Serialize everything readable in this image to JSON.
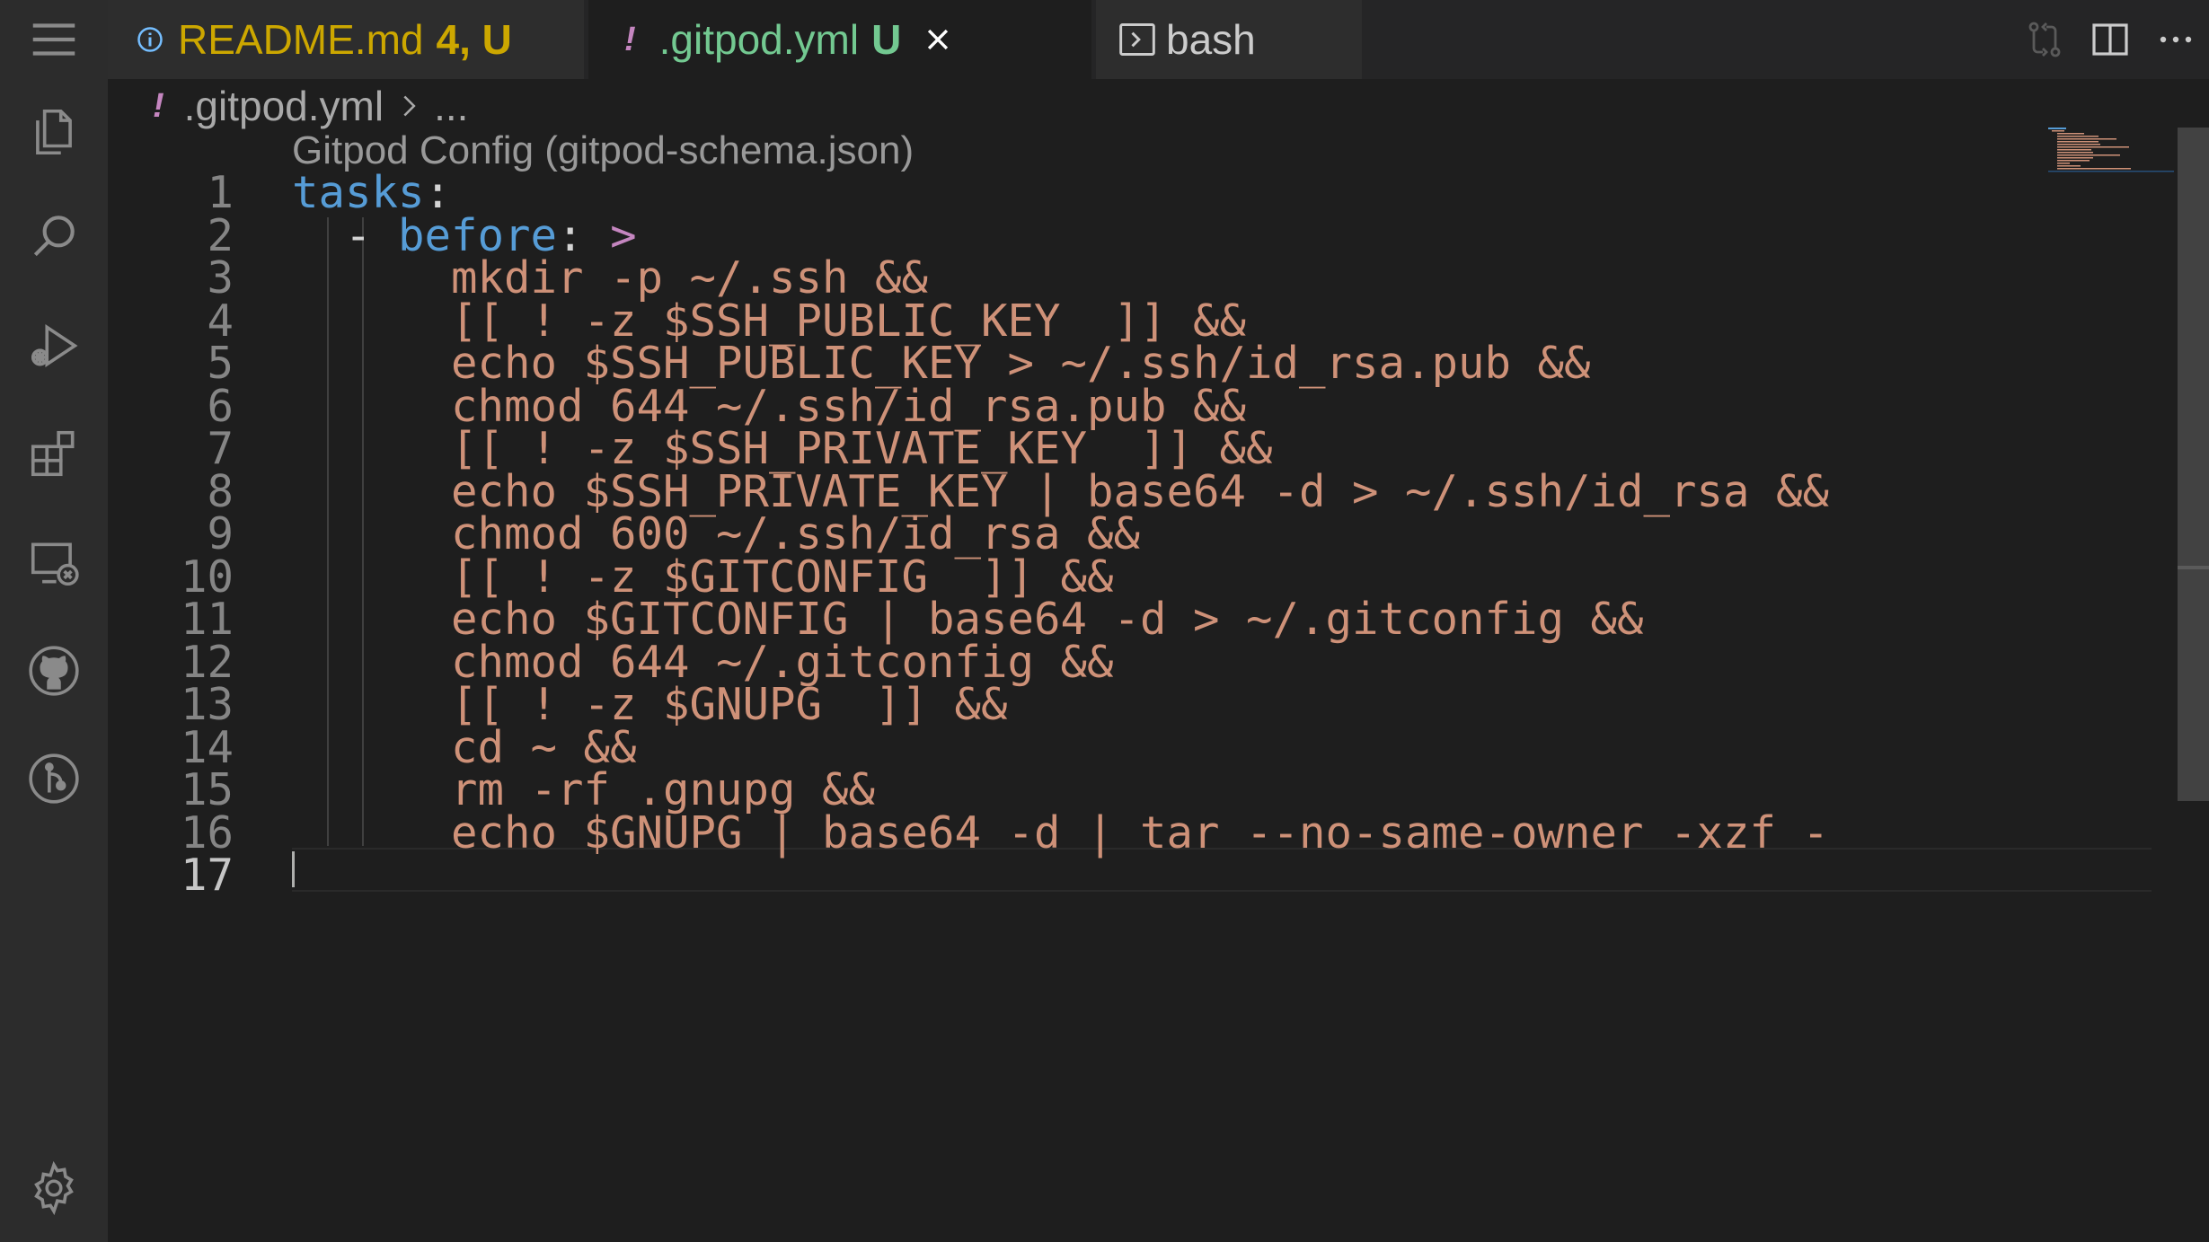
{
  "tabs": {
    "readme": {
      "name": "README.md",
      "badge": "4, U"
    },
    "gitpod": {
      "bang": "!",
      "name": ".gitpod.yml",
      "badge": "U"
    },
    "bash": {
      "name": "bash"
    }
  },
  "breadcrumb": {
    "bang": "!",
    "file": ".gitpod.yml",
    "more": "..."
  },
  "editor": {
    "codelens": "Gitpod Config (gitpod-schema.json)",
    "current_line": 17,
    "line_numbers": [
      "1",
      "2",
      "3",
      "4",
      "5",
      "6",
      "7",
      "8",
      "9",
      "10",
      "11",
      "12",
      "13",
      "14",
      "15",
      "16",
      "17"
    ],
    "line1": {
      "key": "tasks",
      "colon": ":"
    },
    "line2": {
      "dash": "- ",
      "key": "before",
      "colon": ": ",
      "pipe": ">"
    },
    "script_lines": [
      "mkdir -p ~/.ssh &&",
      "[[ ! -z $SSH_PUBLIC_KEY  ]] &&",
      "echo $SSH_PUBLIC_KEY > ~/.ssh/id_rsa.pub &&",
      "chmod 644 ~/.ssh/id_rsa.pub &&",
      "[[ ! -z $SSH_PRIVATE_KEY  ]] &&",
      "echo $SSH_PRIVATE_KEY | base64 -d > ~/.ssh/id_rsa &&",
      "chmod 600 ~/.ssh/id_rsa &&",
      "[[ ! -z $GITCONFIG  ]] &&",
      "echo $GITCONFIG | base64 -d > ~/.gitconfig &&",
      "chmod 644 ~/.gitconfig &&",
      "[[ ! -z $GNUPG  ]] &&",
      "cd ~ &&",
      "rm -rf .gnupg &&",
      "echo $GNUPG | base64 -d | tar --no-same-owner -xzf -"
    ]
  },
  "icons": {
    "activity_bar": [
      "menu-icon",
      "explorer-icon",
      "search-icon",
      "run-debug-icon",
      "extensions-icon",
      "remote-explorer-icon",
      "github-icon",
      "source-control-icon",
      "settings-gear-icon"
    ],
    "title_actions": [
      "open-changes-icon",
      "split-editor-icon",
      "more-actions-icon"
    ]
  },
  "colors": {
    "string": "#ce9178",
    "key": "#569cd6",
    "modified_tab": "#cca700",
    "untracked_tab": "#73c991"
  }
}
